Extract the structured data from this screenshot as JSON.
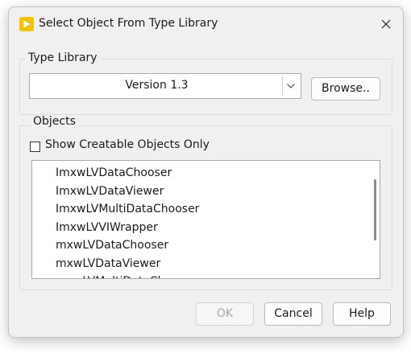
{
  "window": {
    "title": "Select Object From Type Library",
    "icon": "labview-play-icon",
    "close_icon": "close-icon"
  },
  "type_library": {
    "group_label": "Type Library",
    "selected_version": "Version 1.3",
    "dropdown_icon": "chevron-down-icon",
    "browse_label": "Browse.."
  },
  "objects": {
    "group_label": "Objects",
    "show_creatable_label": "Show Creatable Objects Only",
    "show_creatable_checked": false,
    "items": [
      "ImxwLVDataChooser",
      "ImxwLVDataViewer",
      "ImxwLVMultiDataChooser",
      "ImxwLVVIWrapper",
      "mxwLVDataChooser",
      "mxwLVDataViewer",
      "mxwLVMultiDataChooser"
    ]
  },
  "footer": {
    "ok_label": "OK",
    "ok_enabled": false,
    "cancel_label": "Cancel",
    "help_label": "Help"
  },
  "colors": {
    "dialog_bg": "#f0f0f0",
    "icon_yellow": "#f5c400",
    "disabled_text": "#a8a8a8"
  }
}
